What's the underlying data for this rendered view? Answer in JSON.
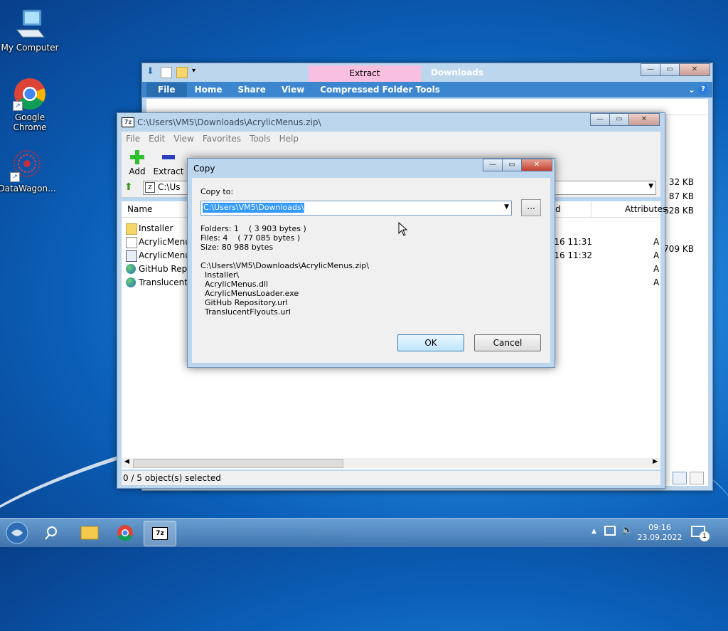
{
  "desktop": {
    "icons": [
      {
        "label": "My Computer"
      },
      {
        "label": "Google Chrome"
      },
      {
        "label": "DataWagon..."
      }
    ]
  },
  "explorer": {
    "context_tab": "Extract",
    "title": "Downloads",
    "ribbon_tabs": [
      "File",
      "Home",
      "Share",
      "View",
      "Compressed Folder Tools"
    ],
    "sizes": [
      "32 KB",
      "87 KB",
      "628 KB",
      "709 KB"
    ]
  },
  "sevenzip": {
    "title": "C:\\Users\\VM5\\Downloads\\AcrylicMenus.zip\\",
    "menu": [
      "File",
      "Edit",
      "View",
      "Favorites",
      "Tools",
      "Help"
    ],
    "toolbar": [
      "Add",
      "Extract"
    ],
    "address": "C:\\Us",
    "columns": {
      "name": "Name",
      "modified": "d",
      "attributes": "Attributes"
    },
    "rows": [
      {
        "name": "Installer",
        "date": "",
        "attr": "",
        "icon": "folder"
      },
      {
        "name": "AcrylicMenus",
        "date": "-16 11:31",
        "attr": "A",
        "icon": "dll"
      },
      {
        "name": "AcrylicMenus",
        "date": "-16 11:32",
        "attr": "A",
        "icon": "exe"
      },
      {
        "name": "GitHub Repo",
        "date": "",
        "attr": "A",
        "icon": "url"
      },
      {
        "name": "TranslucentFl",
        "date": "",
        "attr": "A",
        "icon": "url"
      }
    ],
    "status": "0 / 5 object(s) selected"
  },
  "copy_dialog": {
    "title": "Copy",
    "copy_to_label": "Copy to:",
    "path_value": "C:\\Users\\VM5\\Downloads\\",
    "browse_label": "...",
    "stats": [
      "Folders: 1    ( 3 903 bytes )",
      "Files: 4    ( 77 085 bytes )",
      "Size: 80 988 bytes"
    ],
    "archive_path": "C:\\Users\\VM5\\Downloads\\AcrylicMenus.zip\\",
    "files": [
      "Installer\\",
      "AcrylicMenus.dll",
      "AcrylicMenusLoader.exe",
      "GitHub Repository.url",
      "TranslucentFlyouts.url"
    ],
    "ok_label": "OK",
    "cancel_label": "Cancel"
  },
  "taskbar": {
    "time": "09:16",
    "date": "23.09.2022",
    "notification_count": "1",
    "sevenzip_label": "7z"
  }
}
